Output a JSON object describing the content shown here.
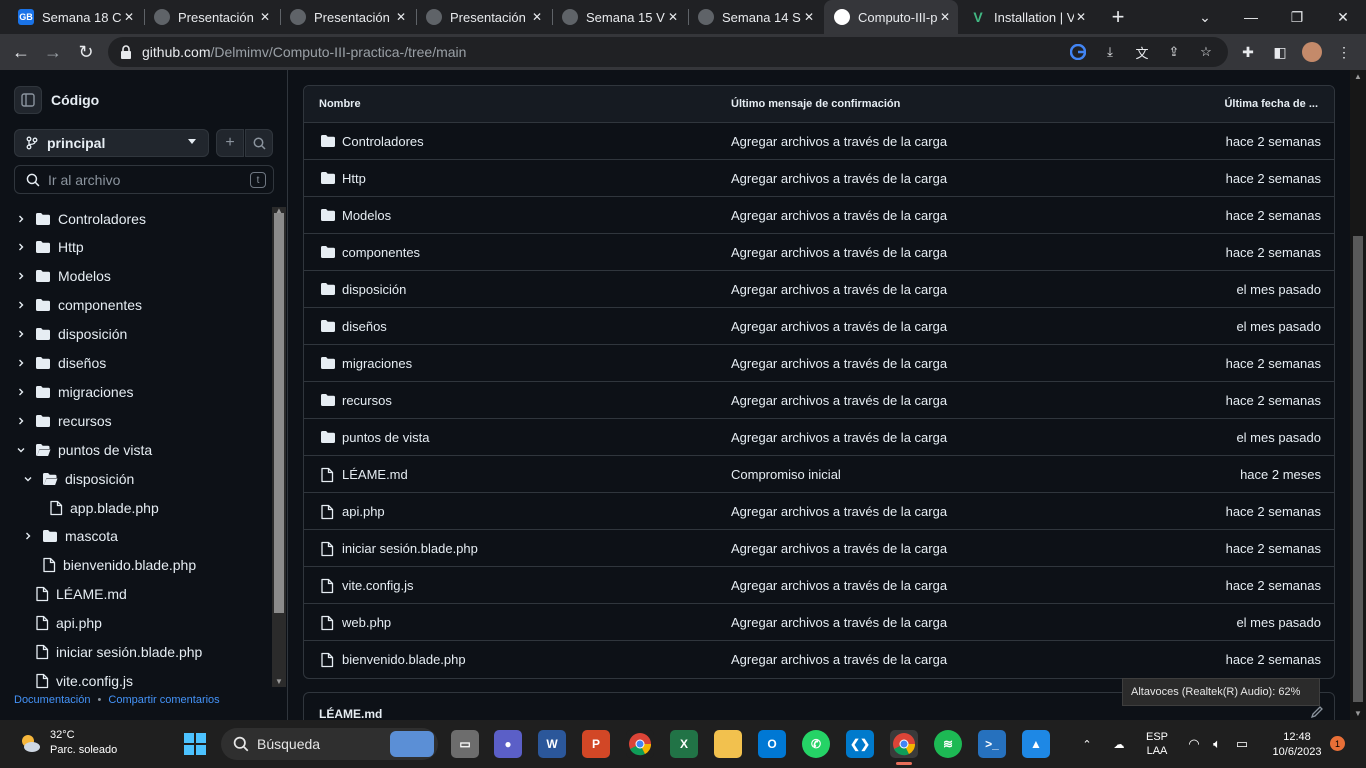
{
  "browser": {
    "tabs": [
      {
        "title": "Semana 18 C",
        "favicon": "gb-icon",
        "active": false
      },
      {
        "title": "Presentación",
        "favicon": "globe-icon",
        "active": false
      },
      {
        "title": "Presentación",
        "favicon": "globe-icon",
        "active": false
      },
      {
        "title": "Presentación",
        "favicon": "globe-icon",
        "active": false
      },
      {
        "title": "Semana 15 V",
        "favicon": "globe-icon",
        "active": false
      },
      {
        "title": "Semana 14 S",
        "favicon": "globe-icon",
        "active": false
      },
      {
        "title": "Computo-III-p",
        "favicon": "github-icon",
        "active": true
      },
      {
        "title": "Installation | V",
        "favicon": "vue-icon",
        "active": false
      }
    ],
    "url_domain": "github.com",
    "url_path": "/Delmimv/Computo-III-practica-/tree/main"
  },
  "sidebar": {
    "title": "Código",
    "branch": "principal",
    "file_search_placeholder": "Ir al archivo",
    "file_search_shortcut": "t",
    "tree": [
      {
        "label": "Controladores",
        "type": "folder",
        "level": 0,
        "expanded": false
      },
      {
        "label": "Http",
        "type": "folder",
        "level": 0,
        "expanded": false
      },
      {
        "label": "Modelos",
        "type": "folder",
        "level": 0,
        "expanded": false
      },
      {
        "label": "componentes",
        "type": "folder",
        "level": 0,
        "expanded": false
      },
      {
        "label": "disposición",
        "type": "folder",
        "level": 0,
        "expanded": false
      },
      {
        "label": "diseños",
        "type": "folder",
        "level": 0,
        "expanded": false
      },
      {
        "label": "migraciones",
        "type": "folder",
        "level": 0,
        "expanded": false
      },
      {
        "label": "recursos",
        "type": "folder",
        "level": 0,
        "expanded": false
      },
      {
        "label": "puntos de vista",
        "type": "folder",
        "level": 0,
        "expanded": true
      },
      {
        "label": "disposición",
        "type": "folder",
        "level": 1,
        "expanded": true
      },
      {
        "label": "app.blade.php",
        "type": "file",
        "level": 2
      },
      {
        "label": "mascota",
        "type": "folder",
        "level": 1,
        "expanded": false
      },
      {
        "label": "bienvenido.blade.php",
        "type": "file",
        "level": 1
      },
      {
        "label": "LÉAME.md",
        "type": "file",
        "level": 0
      },
      {
        "label": "api.php",
        "type": "file",
        "level": 0
      },
      {
        "label": "iniciar sesión.blade.php",
        "type": "file",
        "level": 0
      },
      {
        "label": "vite.config.js",
        "type": "file",
        "level": 0
      }
    ],
    "footer_links": [
      "Documentación",
      "Compartir comentarios"
    ]
  },
  "files": {
    "columns": [
      "Nombre",
      "Último mensaje de confirmación",
      "Última fecha de ..."
    ],
    "rows": [
      {
        "name": "Controladores",
        "type": "folder",
        "message": "Agregar archivos a través de la carga",
        "date": "hace 2 semanas"
      },
      {
        "name": "Http",
        "type": "folder",
        "message": "Agregar archivos a través de la carga",
        "date": "hace 2 semanas"
      },
      {
        "name": "Modelos",
        "type": "folder",
        "message": "Agregar archivos a través de la carga",
        "date": "hace 2 semanas"
      },
      {
        "name": "componentes",
        "type": "folder",
        "message": "Agregar archivos a través de la carga",
        "date": "hace 2 semanas"
      },
      {
        "name": "disposición",
        "type": "folder",
        "message": "Agregar archivos a través de la carga",
        "date": "el mes pasado"
      },
      {
        "name": "diseños",
        "type": "folder",
        "message": "Agregar archivos a través de la carga",
        "date": "el mes pasado"
      },
      {
        "name": "migraciones",
        "type": "folder",
        "message": "Agregar archivos a través de la carga",
        "date": "hace 2 semanas"
      },
      {
        "name": "recursos",
        "type": "folder",
        "message": "Agregar archivos a través de la carga",
        "date": "hace 2 semanas"
      },
      {
        "name": "puntos de vista",
        "type": "folder",
        "message": "Agregar archivos a través de la carga",
        "date": "el mes pasado"
      },
      {
        "name": "LÉAME.md",
        "type": "file",
        "message": "Compromiso inicial",
        "date": "hace 2 meses"
      },
      {
        "name": "api.php",
        "type": "file",
        "message": "Agregar archivos a través de la carga",
        "date": "hace 2 semanas"
      },
      {
        "name": "iniciar sesión.blade.php",
        "type": "file",
        "message": "Agregar archivos a través de la carga",
        "date": "hace 2 semanas"
      },
      {
        "name": "vite.config.js",
        "type": "file",
        "message": "Agregar archivos a través de la carga",
        "date": "hace 2 semanas"
      },
      {
        "name": "web.php",
        "type": "file",
        "message": "Agregar archivos a través de la carga",
        "date": "el mes pasado"
      },
      {
        "name": "bienvenido.blade.php",
        "type": "file",
        "message": "Agregar archivos a través de la carga",
        "date": "hace 2 semanas"
      }
    ]
  },
  "readme": {
    "title": "LÉAME.md"
  },
  "tooltip": "Altavoces (Realtek(R) Audio): 62%",
  "taskbar": {
    "weather_temp": "32°C",
    "weather_desc": "Parc. soleado",
    "search_label": "Búsqueda",
    "lang_1": "ESP",
    "lang_2": "LAA",
    "time": "12:48",
    "date": "10/6/2023",
    "notifications": "1"
  }
}
